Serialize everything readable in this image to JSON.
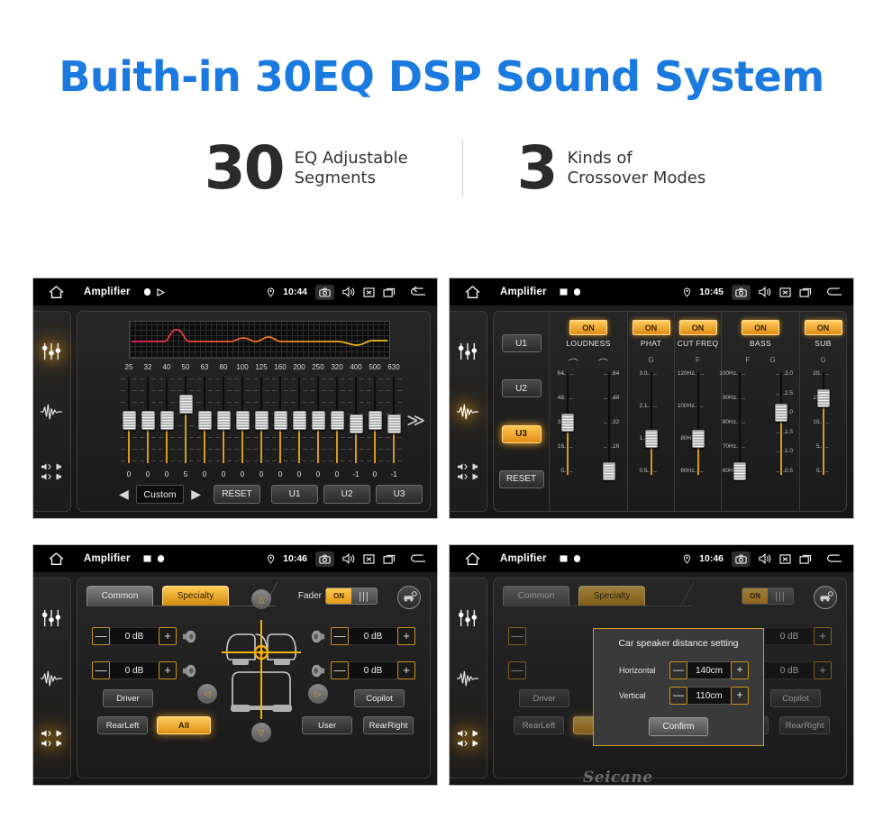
{
  "header": {
    "title": "Buith-in 30EQ DSP Sound System",
    "stats": [
      {
        "number": "30",
        "line1": "EQ Adjustable",
        "line2": "Segments"
      },
      {
        "number": "3",
        "line1": "Kinds of",
        "line2": "Crossover Modes"
      }
    ],
    "title_color": "#1a7ae0"
  },
  "statusbar": {
    "app_title": "Amplifier",
    "times": [
      "10:44",
      "10:45",
      "10:46",
      "10:46"
    ],
    "icons": [
      "home-icon",
      "location-pin-icon",
      "camera-icon",
      "volume-icon",
      "close-box-icon",
      "recents-icon",
      "back-arrow-icon"
    ]
  },
  "sidebar": {
    "items": [
      {
        "name": "equalizer-icon",
        "label": "Equalizer"
      },
      {
        "name": "waveform-icon",
        "label": "Crossover"
      },
      {
        "name": "balance-icon",
        "label": "Balance"
      }
    ]
  },
  "panel_eq": {
    "frequencies": [
      "25",
      "32",
      "40",
      "50",
      "63",
      "80",
      "100",
      "125",
      "160",
      "200",
      "250",
      "320",
      "400",
      "500",
      "630"
    ],
    "values": [
      "0",
      "0",
      "0",
      "5",
      "0",
      "0",
      "0",
      "0",
      "0",
      "0",
      "0",
      "0",
      "-1",
      "0",
      "-1"
    ],
    "preset": "Custom",
    "prev_arrow": "◀",
    "next_arrow": "▶",
    "more_arrow": "≫",
    "reset_label": "RESET",
    "user_presets": [
      "U1",
      "U2",
      "U3"
    ],
    "curve_colors": [
      "#e8195c",
      "#f06a1e",
      "#f0c419"
    ]
  },
  "panel_crossover": {
    "presets": [
      "U1",
      "U2",
      "U3"
    ],
    "active_preset": "U3",
    "reset_label": "RESET",
    "on_label": "ON",
    "sections": [
      {
        "label": "LOUDNESS",
        "on": "ON",
        "sliders": [
          {
            "unit": "",
            "scale": [
              "64",
              "48",
              "32",
              "16",
              "0"
            ],
            "value": "32",
            "side": "left"
          },
          {
            "unit": "",
            "scale": [
              "64",
              "48",
              "32",
              "16",
              "0"
            ],
            "value": "0",
            "side": "right"
          }
        ]
      },
      {
        "label": "PHAT",
        "on": "ON",
        "sliders": [
          {
            "unit": "G",
            "scale": [
              "3.0",
              "2.1",
              "1.3",
              "0.5"
            ],
            "value": "1.3",
            "side": "left"
          }
        ]
      },
      {
        "label": "CUT FREQ",
        "on": "ON",
        "sliders": [
          {
            "unit": "F",
            "scale": [
              "120Hz",
              "100Hz",
              "80Hz",
              "60Hz"
            ],
            "value": "80Hz",
            "side": "left"
          }
        ]
      },
      {
        "label": "BASS",
        "on": "ON",
        "sliders": [
          {
            "unit": "F",
            "scale": [
              "100Hz",
              "90Hz",
              "80Hz",
              "70Hz",
              "60Hz"
            ],
            "value": "60Hz",
            "side": "left"
          },
          {
            "unit": "G",
            "scale": [
              "3.0",
              "2.5",
              "2.0",
              "1.5",
              "1.0",
              "0.5"
            ],
            "value": "2.0",
            "side": "right"
          }
        ]
      },
      {
        "label": "SUB",
        "on": "ON",
        "sliders": [
          {
            "unit": "G",
            "scale": [
              "20",
              "15",
              "10",
              "5",
              "0"
            ],
            "value": "15",
            "side": "left"
          }
        ]
      }
    ]
  },
  "panel_fader": {
    "tabs": [
      {
        "label": "Common",
        "active": false
      },
      {
        "label": "Specialty",
        "active": true
      }
    ],
    "fader_label": "Fader",
    "toggle_on": "ON",
    "car_settings_icon": "car-settings-icon",
    "gains": [
      {
        "position": "front-left",
        "value": "0 dB"
      },
      {
        "position": "front-right",
        "value": "0 dB"
      },
      {
        "position": "rear-left",
        "value": "0 dB"
      },
      {
        "position": "rear-right",
        "value": "0 dB"
      }
    ],
    "minus": "—",
    "plus": "+",
    "position_buttons": [
      {
        "label": "Driver",
        "active": false
      },
      {
        "label": "Copilot",
        "active": false
      },
      {
        "label": "RearLeft",
        "active": false
      },
      {
        "label": "All",
        "active": true
      },
      {
        "label": "User",
        "active": false
      },
      {
        "label": "RearRight",
        "active": false
      }
    ],
    "nav_arrows": [
      "△",
      "◁",
      "▷",
      "▽"
    ]
  },
  "dialog": {
    "title": "Car speaker distance setting",
    "rows": [
      {
        "label": "Horizontal",
        "value": "140cm"
      },
      {
        "label": "Vertical",
        "value": "110cm"
      }
    ],
    "minus": "—",
    "plus": "+",
    "confirm_label": "Confirm"
  },
  "watermark": {
    "text": "Seicane"
  }
}
